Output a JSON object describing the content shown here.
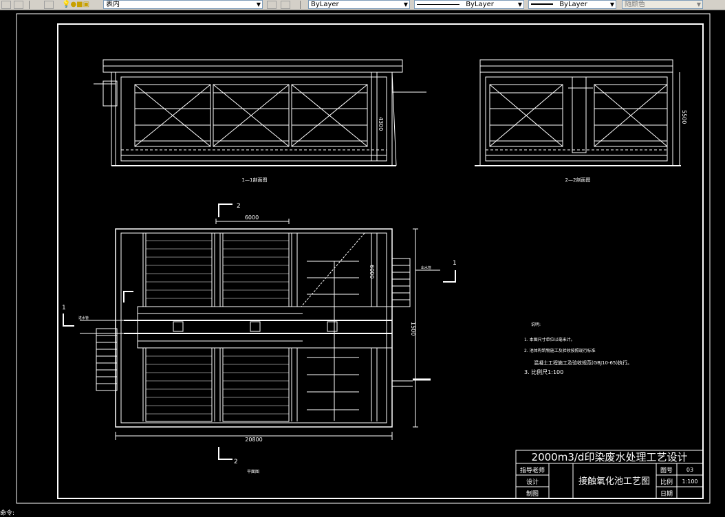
{
  "toolbar": {
    "layer_name": "表内",
    "color": "ByLayer",
    "linetype": "ByLayer",
    "lineweight": "ByLayer",
    "plot_style": "随颜色"
  },
  "drawing": {
    "section1_label": "1—1剖面图",
    "section2_label": "2—2剖面图",
    "plan_label": "平面图",
    "dim_6000_top": "6000",
    "dim_6000_side": "6000",
    "dim_1500": "1500",
    "dim_20800": "20800",
    "dim_5500": "5500",
    "dim_4300": "4300",
    "cut_mark_1": "1",
    "cut_mark_2": "2",
    "inlet_label": "进水管",
    "outlet_label": "出水管",
    "notes_title": "说明:",
    "note1": "1. 本图尺寸单位以毫米计。",
    "note2": "2. 池体构筑物施工及验收按照现行标准",
    "note2b": "混凝土工程施工及验收规范(GBJ10-65)执行。",
    "note3": "3. 比例尺1:100"
  },
  "title_block": {
    "title": "2000m3/d印染废水处理工艺设计",
    "drawing_name": "接触氧化池工艺图",
    "instructor_label": "指导老师",
    "design_label": "设计",
    "draw_label": "制图",
    "sheet_label": "图号",
    "sheet_value": "03",
    "scale_label": "比例",
    "scale_value": "1:100",
    "date_label": "日期"
  },
  "command_line": "命令: "
}
